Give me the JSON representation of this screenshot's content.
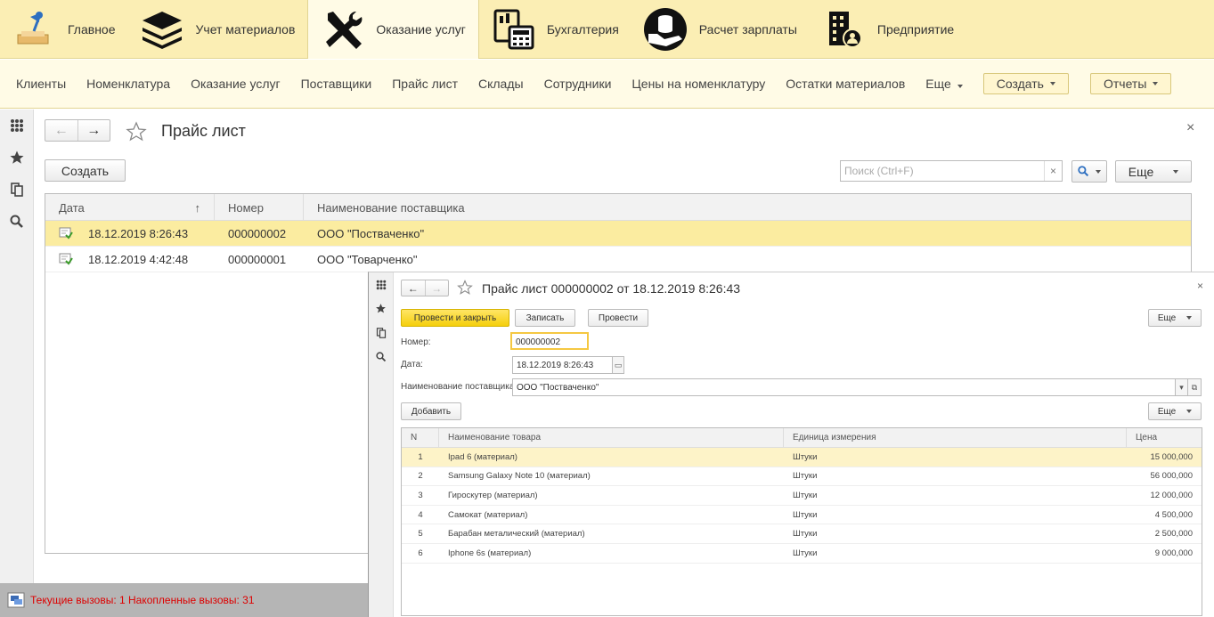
{
  "sections": [
    {
      "label": "Главное",
      "icon": "desk-lamp-icon",
      "active": false
    },
    {
      "label": "Учет материалов",
      "icon": "layers-icon",
      "active": false
    },
    {
      "label": "Оказание услуг",
      "icon": "tools-icon",
      "active": true
    },
    {
      "label": "Бухгалтерия",
      "icon": "accounting-calculator-icon",
      "active": false
    },
    {
      "label": "Расчет зарплаты",
      "icon": "coins-hand-icon",
      "active": false
    },
    {
      "label": "Предприятие",
      "icon": "building-person-icon",
      "active": false
    }
  ],
  "functions": {
    "links": [
      "Клиенты",
      "Номенклатура",
      "Оказание услуг",
      "Поставщики",
      "Прайс лист",
      "Склады",
      "Сотрудники",
      "Цены на номенклатуру",
      "Остатки материалов"
    ],
    "more_label": "Еще",
    "create_label": "Создать",
    "reports_label": "Отчеты"
  },
  "list": {
    "title": "Прайс лист",
    "create_label": "Создать",
    "search_placeholder": "Поиск (Ctrl+F)",
    "more_label": "Еще",
    "columns": [
      "Дата",
      "Номер",
      "Наименование поставщика"
    ],
    "sort_indicator": "↑",
    "rows": [
      {
        "date": "18.12.2019 8:26:43",
        "number": "000000002",
        "supplier": "ООО \"Постваченко\"",
        "selected": true
      },
      {
        "date": "18.12.2019 4:42:48",
        "number": "000000001",
        "supplier": "ООО \"Товарченко\"",
        "selected": false
      }
    ]
  },
  "status": {
    "text": "Текущие вызовы: 1   Накопленные вызовы: 31"
  },
  "document": {
    "title": "Прайс лист 000000002 от 18.12.2019 8:26:43",
    "post_close_label": "Провести и закрыть",
    "save_label": "Записать",
    "post_label": "Провести",
    "more_label": "Еще",
    "number_label": "Номер:",
    "number_value": "000000002",
    "date_label": "Дата:",
    "date_value": "18.12.2019  8:26:43",
    "supplier_label": "Наименование поставщика:",
    "supplier_value": "ООО \"Постваченко\"",
    "add_label": "Добавить",
    "table_more_label": "Еще",
    "columns": [
      "N",
      "Наименование товара",
      "Единица измерения",
      "Цена"
    ],
    "rows": [
      {
        "n": "1",
        "name": "Ipad 6 (материал)",
        "unit": "Штуки",
        "price": "15 000,000"
      },
      {
        "n": "2",
        "name": "Samsung Galaxy Note 10 (материал)",
        "unit": "Штуки",
        "price": "56 000,000"
      },
      {
        "n": "3",
        "name": "Гироскутер (материал)",
        "unit": "Штуки",
        "price": "12 000,000"
      },
      {
        "n": "4",
        "name": "Самокат (материал)",
        "unit": "Штуки",
        "price": "4 500,000"
      },
      {
        "n": "5",
        "name": "Барабан металический (материал)",
        "unit": "Штуки",
        "price": "2 500,000"
      },
      {
        "n": "6",
        "name": "Iphone 6s (материал)",
        "unit": "Штуки",
        "price": "9 000,000"
      }
    ]
  }
}
